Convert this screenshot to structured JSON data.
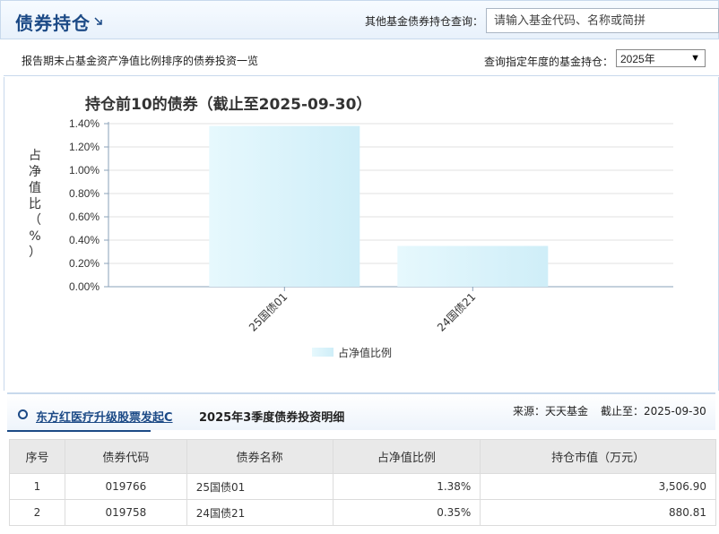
{
  "header": {
    "title": "债券持仓",
    "search_label": "其他基金债券持仓查询：",
    "search_placeholder": "请输入基金代码、名称或简拼"
  },
  "subheader": {
    "description": "报告期末占基金资产净值比例排序的债券投资一览",
    "year_label": "查询指定年度的基金持仓：",
    "year_value": "2025年"
  },
  "chart_data": {
    "type": "bar",
    "title": "持仓前10的债券（截止至2025-09-30）",
    "ylabel": "占净值比（%）",
    "xlabel": "",
    "categories": [
      "25国债01",
      "24国债21"
    ],
    "series": [
      {
        "name": "占净值比例",
        "values": [
          1.38,
          0.35
        ]
      }
    ],
    "ylim": [
      0,
      1.4
    ],
    "yticks": [
      "0.00%",
      "0.20%",
      "0.40%",
      "0.60%",
      "0.80%",
      "1.00%",
      "1.20%",
      "1.40%"
    ],
    "grid": true,
    "legend": "bottom-center",
    "bar_color": "#cfeef8"
  },
  "detail": {
    "fund_name": "东方红医疗升级股票发起C",
    "title": "2025年3季度债券投资明细",
    "source": "来源：天天基金",
    "as_of": "截止至：2025-09-30",
    "columns": [
      "序号",
      "债券代码",
      "债券名称",
      "占净值比例",
      "持仓市值（万元）"
    ],
    "rows": [
      [
        "1",
        "019766",
        "25国债01",
        "1.38%",
        "3,506.90"
      ],
      [
        "2",
        "019758",
        "24国债21",
        "0.35%",
        "880.81"
      ]
    ]
  },
  "colors": {
    "accent": "#1c4a86",
    "border": "#c8d9ec"
  }
}
